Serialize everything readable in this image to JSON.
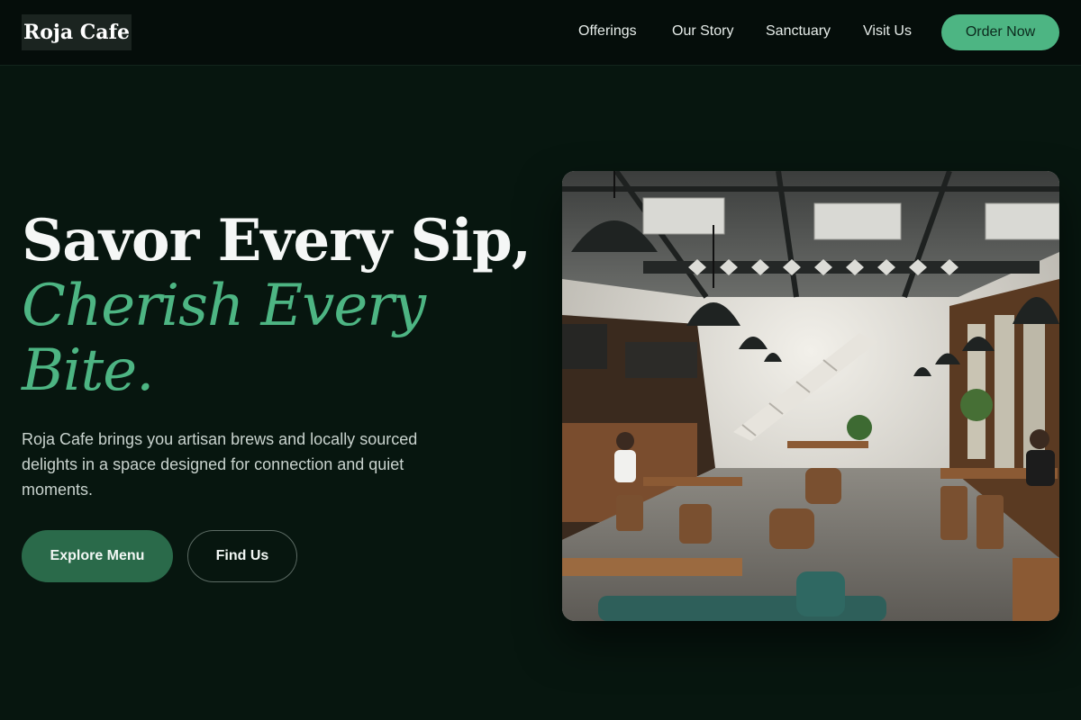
{
  "brand": {
    "name": "Roja Cafe"
  },
  "nav": {
    "links": [
      "Offerings",
      "Our Story",
      "Sanctuary",
      "Visit Us"
    ],
    "cta_label": "Order Now"
  },
  "hero": {
    "headline_line1": "Savor Every Sip,",
    "headline_line2": "Cherish Every Bite.",
    "intro": "Roja Cafe brings you artisan brews and locally sourced delights in a space designed for connection and quiet moments.",
    "primary_button": "Explore Menu",
    "secondary_button": "Find Us",
    "image_subject": "cafe-interior-photo"
  },
  "colors": {
    "background": "#07160f",
    "topbar": "#050d0a",
    "accent": "#4db583",
    "primary_button": "#2a6a4a"
  }
}
